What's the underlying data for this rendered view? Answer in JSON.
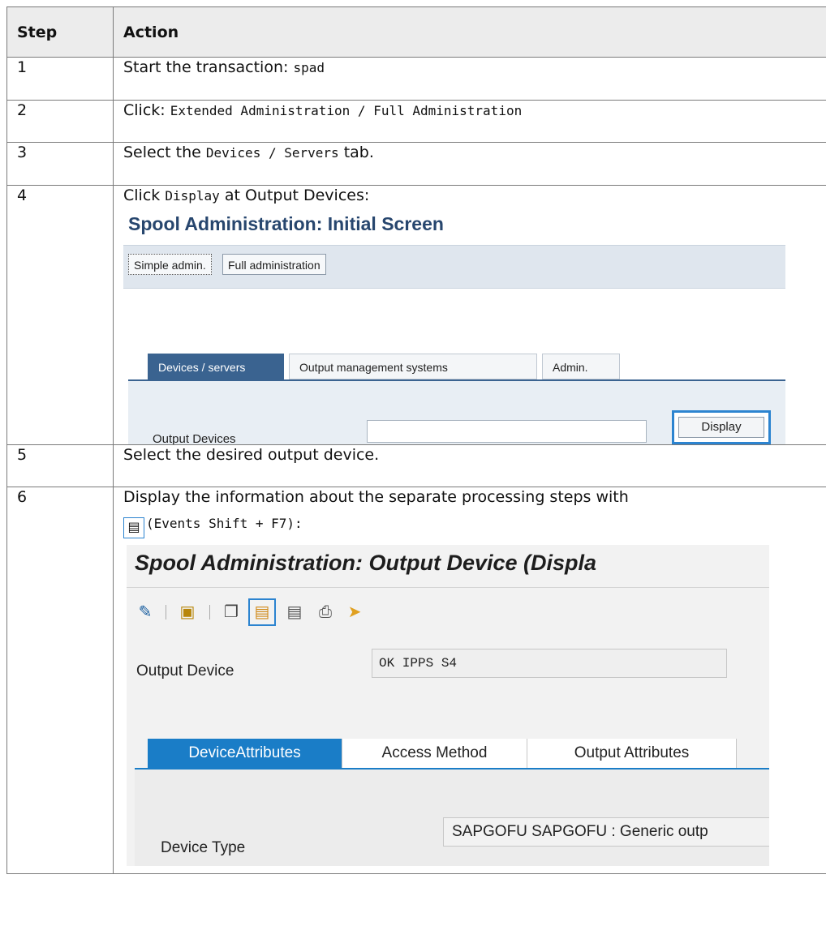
{
  "table": {
    "headers": [
      "Step",
      "Action"
    ],
    "rows": [
      {
        "step": "1",
        "text": "Start the transaction:",
        "code": "spad"
      },
      {
        "step": "2",
        "text": "Click:",
        "code": "Extended Administration / Full Administration"
      },
      {
        "step": "3",
        "text_before": "Select the",
        "code": "Devices / Servers",
        "text_after": "tab."
      },
      {
        "step": "4",
        "text_before": "Click",
        "code": "Display",
        "text_after": "at Output Devices:"
      },
      {
        "step": "5",
        "text": "Select the desired output device."
      },
      {
        "step": "6",
        "text": "Display the information about the separate processing steps with",
        "code": "(Events Shift + F7):"
      }
    ]
  },
  "screen1": {
    "title": "Spool Administration: Initial Screen",
    "buttons": [
      "Simple admin.",
      "Full administration"
    ],
    "tabs": [
      "Devices / servers",
      "Output management systems",
      "Admin."
    ],
    "output_devices_label": "Output Devices",
    "display_button": "Display"
  },
  "screen2": {
    "title": "Spool Administration: Output Device (Displa",
    "icons": [
      "pencil-icon",
      "glasses-icon",
      "copy-icon",
      "printer-events-icon",
      "list-icon",
      "print-icon",
      "export-icon"
    ],
    "output_device_label": "Output Device",
    "output_device_value": "OK IPPS S4",
    "tabs": [
      "DeviceAttributes",
      "Access Method",
      "Output Attributes"
    ],
    "device_type_label": "Device Type",
    "device_type_value": "SAPGOFU SAPGOFU : Generic outp"
  }
}
